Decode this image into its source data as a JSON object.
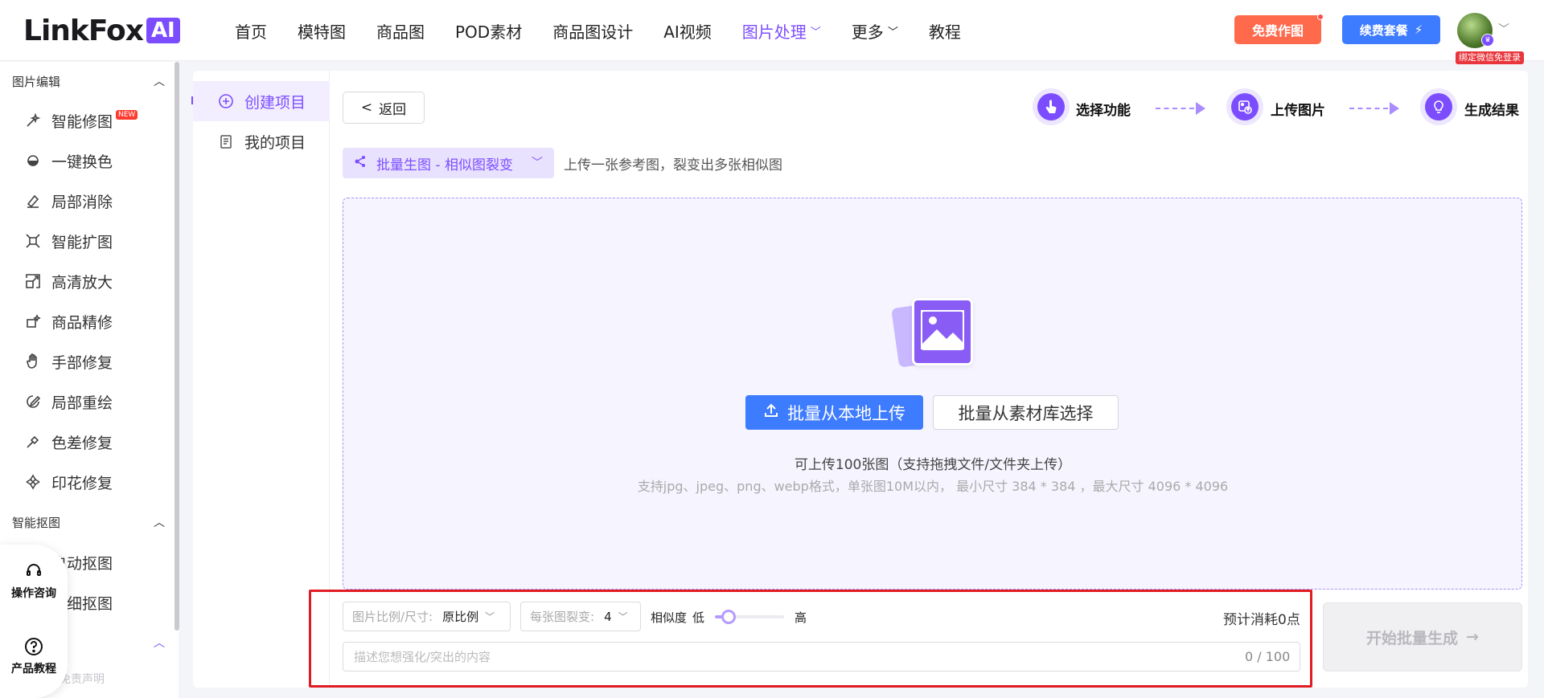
{
  "header": {
    "logo_text": "LinkFox",
    "logo_badge": "AI",
    "nav": [
      {
        "label": "首页"
      },
      {
        "label": "模特图"
      },
      {
        "label": "商品图"
      },
      {
        "label": "POD素材"
      },
      {
        "label": "商品图设计"
      },
      {
        "label": "AI视频"
      },
      {
        "label": "图片处理",
        "active": true,
        "has_dropdown": true
      },
      {
        "label": "更多",
        "has_dropdown": true
      },
      {
        "label": "教程"
      }
    ],
    "free_btn": "免费作图",
    "renew_btn": "续费套餐",
    "renew_icon": "⚡",
    "bind_wechat": "绑定微信免登录"
  },
  "sidebar": {
    "sections": [
      {
        "title": "图片编辑",
        "items": [
          {
            "label": "智能修图",
            "icon": "magic-wand-icon",
            "badge": "NEW"
          },
          {
            "label": "一键换色",
            "icon": "color-swap-icon"
          },
          {
            "label": "局部消除",
            "icon": "eraser-icon"
          },
          {
            "label": "智能扩图",
            "icon": "expand-icon"
          },
          {
            "label": "高清放大",
            "icon": "upscale-icon"
          },
          {
            "label": "商品精修",
            "icon": "retouch-icon"
          },
          {
            "label": "手部修复",
            "icon": "hand-icon"
          },
          {
            "label": "局部重绘",
            "icon": "redraw-icon"
          },
          {
            "label": "色差修复",
            "icon": "color-fix-icon"
          },
          {
            "label": "印花修复",
            "icon": "pattern-icon"
          }
        ]
      },
      {
        "title": "智能抠图",
        "items": [
          {
            "label": "自动抠图",
            "icon": "auto-cutout-icon"
          },
          {
            "label": "精细抠图",
            "icon": "fine-cutout-icon"
          }
        ]
      }
    ],
    "disclaimer": "免责声明",
    "floating": {
      "consult": "操作咨询",
      "tutorial": "产品教程"
    }
  },
  "projects": {
    "create": "创建项目",
    "mine": "我的项目"
  },
  "toolbar": {
    "back": "返回"
  },
  "steps": [
    {
      "label": "选择功能",
      "icon": "pointer-icon"
    },
    {
      "label": "上传图片",
      "icon": "image-upload-icon"
    },
    {
      "label": "生成结果",
      "icon": "bulb-icon"
    }
  ],
  "mode": {
    "selected": "批量生图 - 相似图裂变",
    "description": "上传一张参考图，裂变出多张相似图"
  },
  "upload": {
    "local_btn": "批量从本地上传",
    "library_btn": "批量从素材库选择",
    "hint_main": "可上传100张图（支持拖拽文件/文件夹上传）",
    "hint_formats": "支持jpg、jpeg、png、webp格式，单张图10M以内， 最小尺寸 384 * 384 ，最大尺寸 4096 * 4096"
  },
  "options": {
    "ratio_label": "图片比例/尺寸:",
    "ratio_value": "原比例",
    "split_label": "每张图裂变:",
    "split_value": "4",
    "similarity_label": "相似度",
    "similarity_low": "低",
    "similarity_high": "高",
    "similarity_level": 0.2,
    "cost": "预计消耗0点",
    "desc_placeholder": "描述您想强化/突出的内容",
    "desc_count": "0 / 100",
    "start_btn": "开始批量生成",
    "start_arrow": "→"
  },
  "colors": {
    "accent": "#7c4dff",
    "primary_blue": "#3d7bff",
    "free_orange": "#ff6a4d",
    "highlight_red": "#e01b24"
  }
}
